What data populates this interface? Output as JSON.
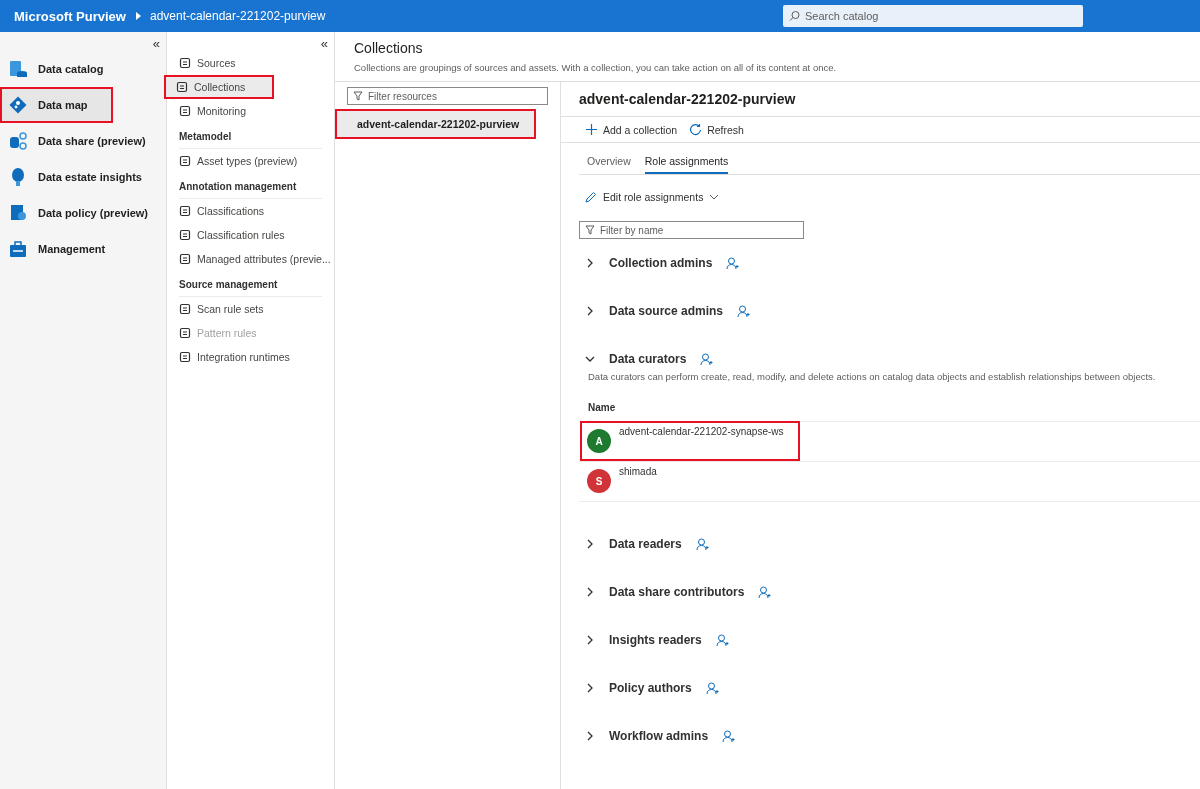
{
  "topbar": {
    "app_name": "Microsoft Purview",
    "breadcrumb": "advent-calendar-221202-purview",
    "search": {
      "placeholder": "Search catalog"
    }
  },
  "sidebar": {
    "collapse": "«",
    "items": [
      {
        "label": "Data catalog",
        "selected": false,
        "highlighted": false
      },
      {
        "label": "Data map",
        "selected": true,
        "highlighted": true
      },
      {
        "label": "Data share (preview)",
        "selected": false,
        "highlighted": false
      },
      {
        "label": "Data estate insights",
        "selected": false,
        "highlighted": false
      },
      {
        "label": "Data policy (preview)",
        "selected": false,
        "highlighted": false
      },
      {
        "label": "Management",
        "selected": false,
        "highlighted": false
      }
    ]
  },
  "subnav": {
    "collapse": "«",
    "items": [
      {
        "kind": "item",
        "label": "Sources",
        "selected": false,
        "highlighted": false,
        "disabled": false
      },
      {
        "kind": "item",
        "label": "Collections",
        "selected": true,
        "highlighted": true,
        "disabled": false
      },
      {
        "kind": "item",
        "label": "Monitoring",
        "selected": false,
        "highlighted": false,
        "disabled": false
      },
      {
        "kind": "header",
        "label": "Metamodel"
      },
      {
        "kind": "item",
        "label": "Asset types (preview)",
        "selected": false,
        "highlighted": false,
        "disabled": false
      },
      {
        "kind": "header",
        "label": "Annotation management"
      },
      {
        "kind": "item",
        "label": "Classifications",
        "selected": false,
        "highlighted": false,
        "disabled": false
      },
      {
        "kind": "item",
        "label": "Classification rules",
        "selected": false,
        "highlighted": false,
        "disabled": false
      },
      {
        "kind": "item",
        "label": "Managed attributes (previe...",
        "selected": false,
        "highlighted": false,
        "disabled": false
      },
      {
        "kind": "header",
        "label": "Source management"
      },
      {
        "kind": "item",
        "label": "Scan rule sets",
        "selected": false,
        "highlighted": false,
        "disabled": false
      },
      {
        "kind": "item",
        "label": "Pattern rules",
        "selected": false,
        "highlighted": false,
        "disabled": true
      },
      {
        "kind": "item",
        "label": "Integration runtimes",
        "selected": false,
        "highlighted": false,
        "disabled": false
      }
    ]
  },
  "page": {
    "title": "Collections",
    "description": "Collections are groupings of sources and assets. With a collection, you can take action on all of its content at once."
  },
  "collection_list": {
    "filter": {
      "placeholder": "Filter resources"
    },
    "items": [
      {
        "label": "advent-calendar-221202-purview",
        "selected": true,
        "highlighted": true
      }
    ]
  },
  "detail": {
    "title": "advent-calendar-221202-purview",
    "toolbar": [
      "Add a collection",
      "Refresh"
    ],
    "tabs": [
      {
        "label": "Overview",
        "selected": false
      },
      {
        "label": "Role assignments",
        "selected": true
      }
    ],
    "edit_button": "Edit role assignments",
    "filter": {
      "placeholder": "Filter by name"
    },
    "roles": [
      {
        "name": "Collection admins",
        "expanded": false
      },
      {
        "name": "Data source admins",
        "expanded": false
      },
      {
        "name": "Data curators",
        "expanded": true,
        "description": "Data curators can perform create, read, modify, and delete actions on catalog data objects and establish relationships between objects.",
        "column": "Name",
        "members": [
          {
            "initial": "A",
            "name": "advent-calendar-221202-synapse-ws",
            "color": "#1e7a2e",
            "highlighted": true
          },
          {
            "initial": "S",
            "name": "shimada",
            "color": "#d13438",
            "highlighted": false
          }
        ]
      },
      {
        "name": "Data readers",
        "expanded": false
      },
      {
        "name": "Data share contributors",
        "expanded": false
      },
      {
        "name": "Insights readers",
        "expanded": false
      },
      {
        "name": "Policy authors",
        "expanded": false
      },
      {
        "name": "Workflow admins",
        "expanded": false
      }
    ]
  }
}
